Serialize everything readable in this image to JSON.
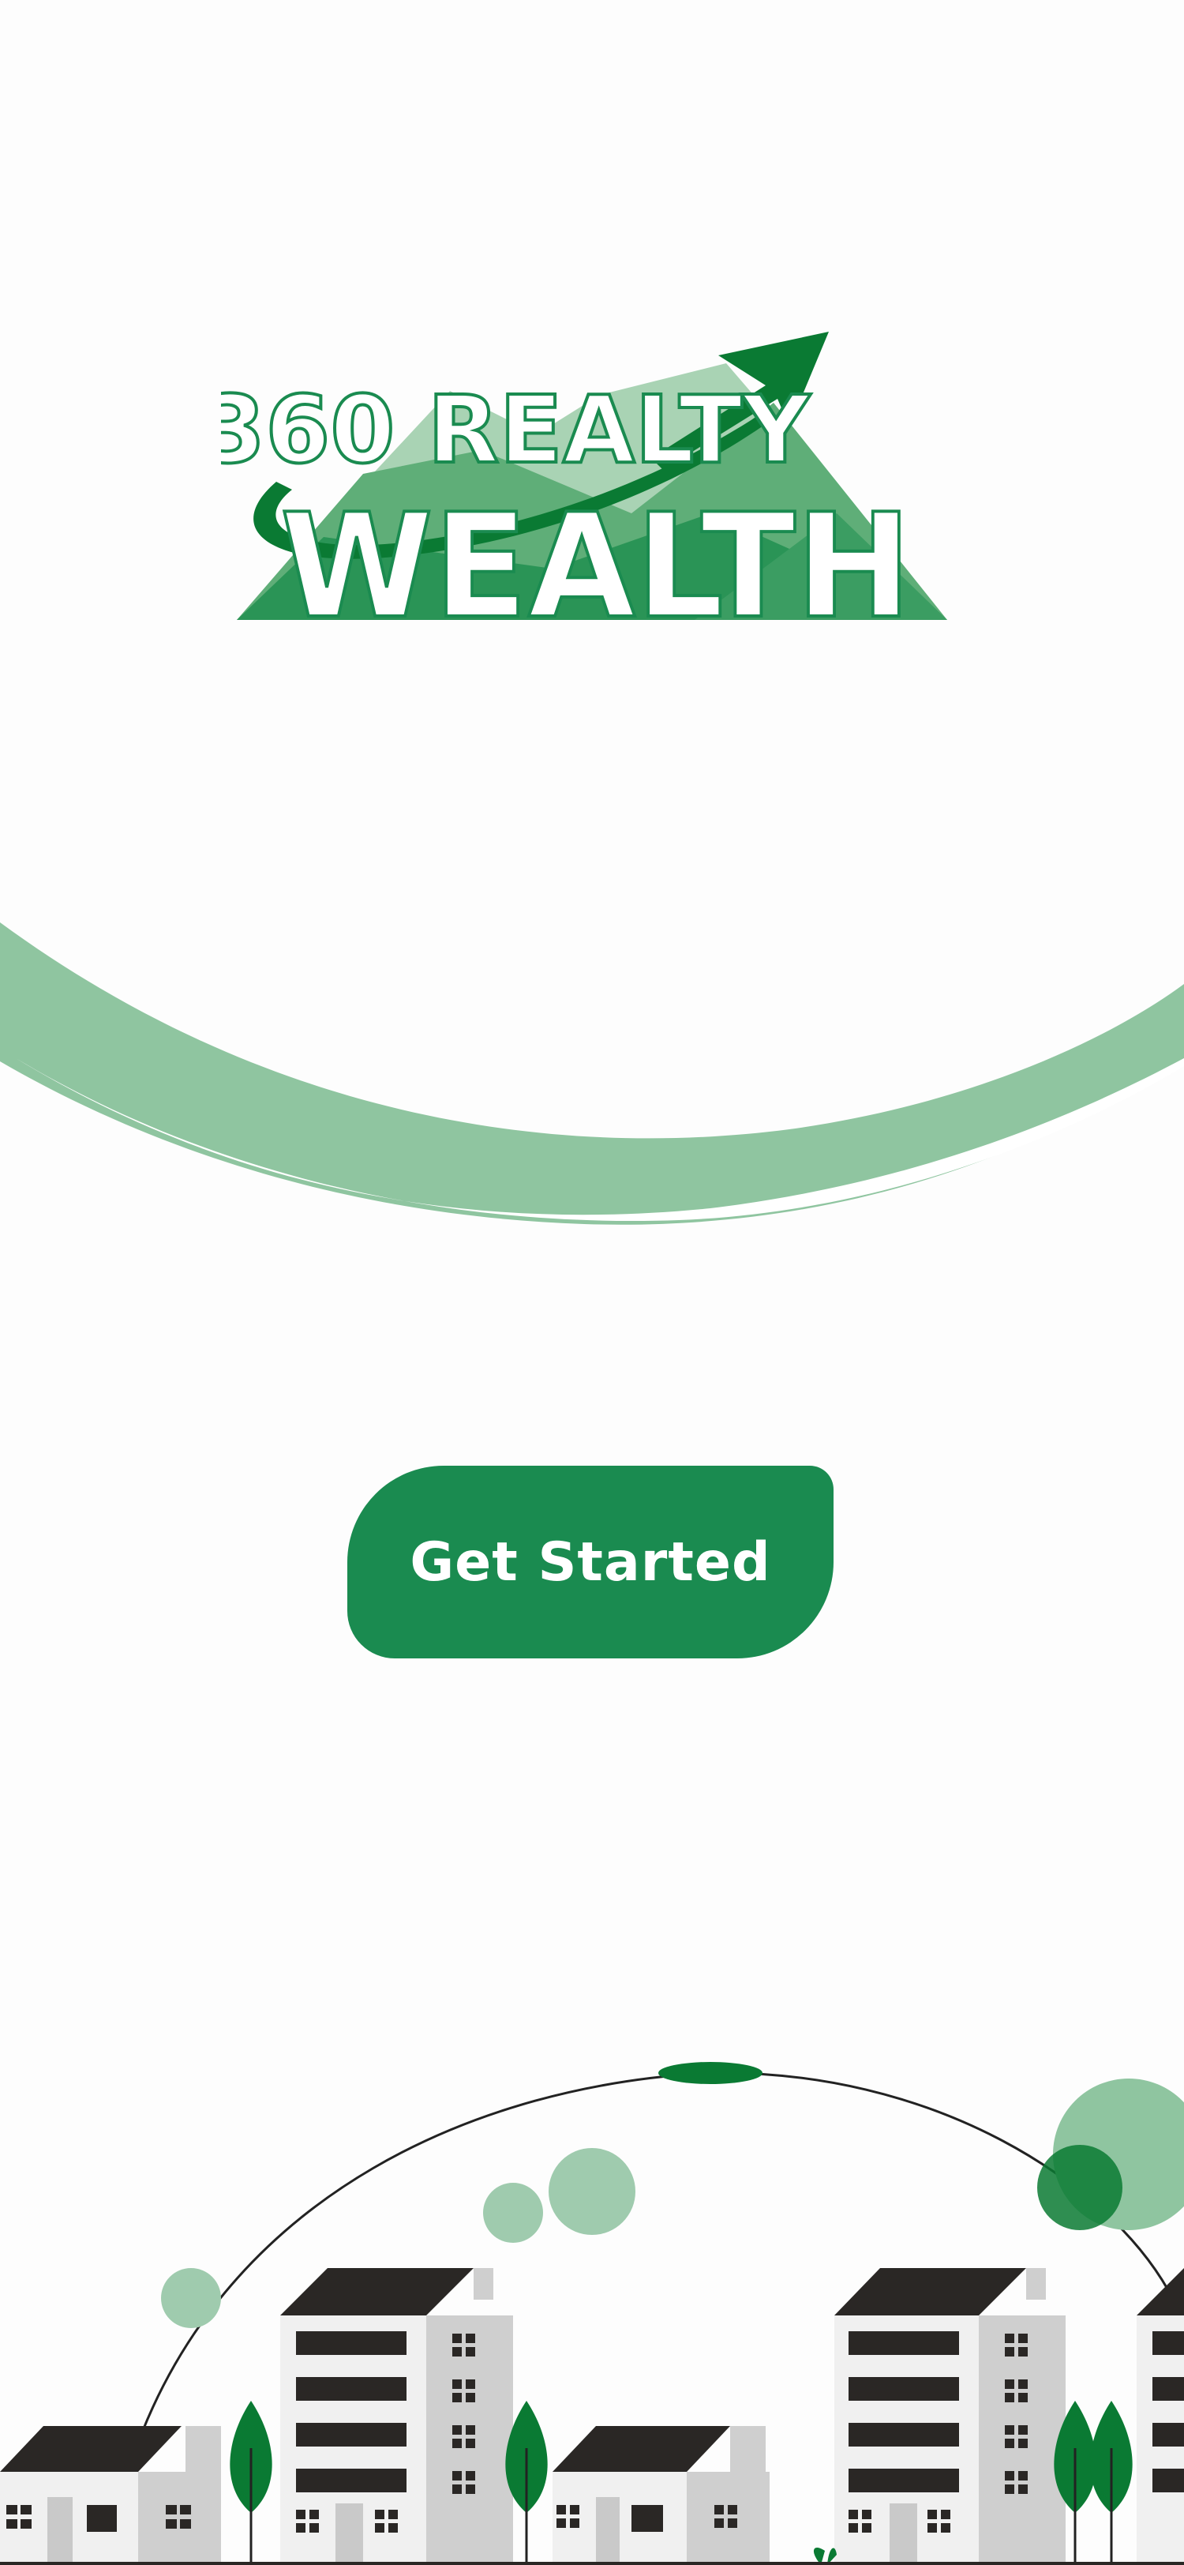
{
  "brand": {
    "logo_line1": "360 REALTY",
    "logo_line2": "WEALTH",
    "primary_color": "#1a8b50",
    "dark_green": "#0a7a33",
    "light_green": "#8fc5a0"
  },
  "actions": {
    "get_started_label": "Get Started"
  },
  "icons": {
    "logo": "growth-arrow-mountain-logo",
    "decoration": "green-swoosh",
    "illustration": "city-buildings-illustration"
  }
}
